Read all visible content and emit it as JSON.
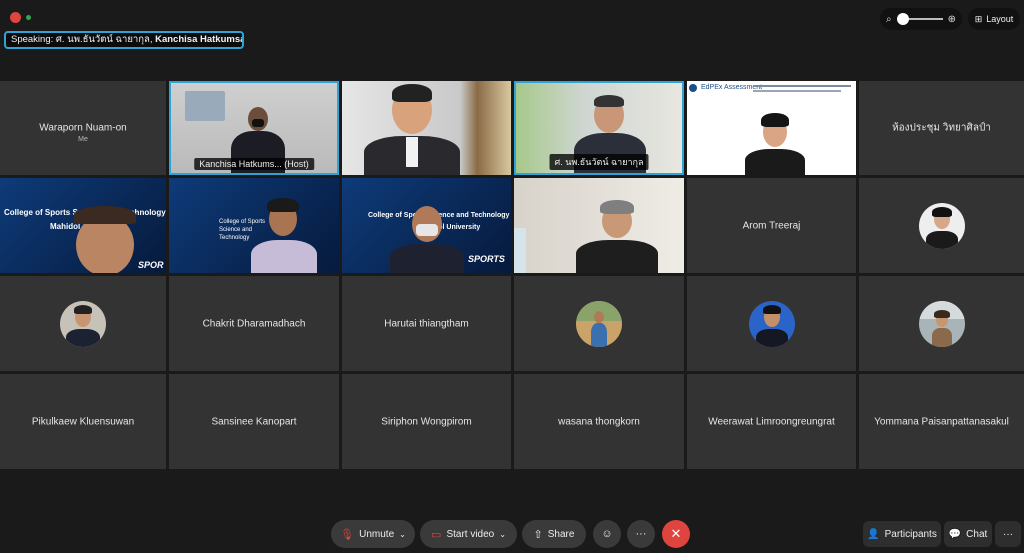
{
  "top": {
    "speaking_prefix": "Speaking:",
    "speaking_names_regular": "ศ. นพ.ธันวัตน์ ฉายากุล,",
    "speaking_names_bold": "Kanchisa Hatkumsap (...",
    "layout_label": "Layout",
    "zoom_minus": "🔍",
    "zoom_plus": "⊕"
  },
  "tiles": {
    "r1c1_name": "Waraporn Nuam-on",
    "r1c1_sub": "Me",
    "r1c2_plate": "Kanchisa Hatkums... (Host)",
    "r1c4_plate": "ศ. นพ.ธันวัตน์ ฉายากุล",
    "r1c5_header": "EdPEx Assessment",
    "r1c6_name": "ห้องประชุม วิทยาศิลป์า",
    "r2c1_text": "College of Sports Science and Technology",
    "r2c1_text2": "Mahidol",
    "r2c1_text3": "SPOR",
    "r2c2_text": "College of Sports Science and Technology",
    "r2c3_text": "College of Sports Science and Technology",
    "r2c3_text2": "Mahidol University",
    "r2c3_text3": "SPORTS",
    "r2c5_name": "Arom Treeraj",
    "r3c2_name": "Chakrit Dharamadhach",
    "r3c3_name": "Harutai thiangtham",
    "r4c1_name": "Pikulkaew Kluensuwan",
    "r4c2_name": "Sansinee Kanopart",
    "r4c3_name": "Siriphon Wongpirom",
    "r4c4_name": "wasana thongkorn",
    "r4c5_name": "Weerawat Limroongreungrat",
    "r4c6_name": "Yommana Paisanpattanasakul"
  },
  "controls": {
    "unmute": "Unmute",
    "start_video": "Start video",
    "share": "Share",
    "reactions_icon": "☺",
    "more_icon": "···",
    "leave_icon": "✕",
    "participants": "Participants",
    "chat": "Chat",
    "overflow_icon": "···"
  },
  "colors": {
    "accent": "#2ea3d6",
    "leave": "#e0443e",
    "tile_bg": "#333333"
  }
}
